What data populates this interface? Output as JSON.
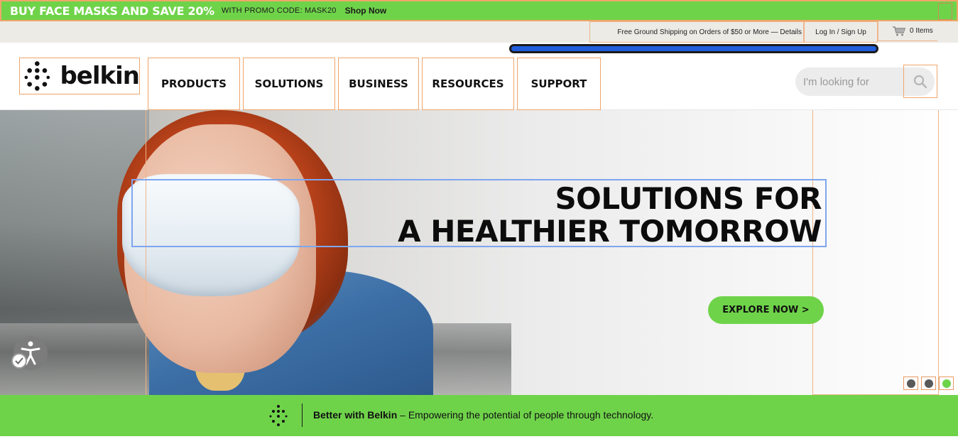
{
  "promo": {
    "headline": "BUY FACE MASKS AND SAVE 20%",
    "code_text": "WITH PROMO CODE: MASK20",
    "shop_link": "Shop Now"
  },
  "utility": {
    "shipping": "Free Ground Shipping on Orders of $50 or More — Details",
    "login": "Log In / Sign Up",
    "cart": "0 Items"
  },
  "header": {
    "logo_text": "belkin",
    "nav": [
      "PRODUCTS",
      "SOLUTIONS",
      "BUSINESS",
      "RESOURCES",
      "SUPPORT"
    ],
    "search_placeholder": "I'm looking for"
  },
  "hero": {
    "title_line1": "SOLUTIONS FOR",
    "title_line2": "A HEALTHIER TOMORROW",
    "cta": "EXPLORE NOW >",
    "slides": 3,
    "active_slide": 3
  },
  "tagline": {
    "brand": "Better with Belkin",
    "text": " – Empowering the potential of people through technology."
  },
  "colors": {
    "brand_green": "#6fd34a",
    "loading_blue": "#1f5ddb",
    "text_dark": "#111111"
  },
  "icons": [
    "belkin-logo-icon",
    "search-icon",
    "cart-icon",
    "accessibility-icon",
    "check-icon"
  ]
}
